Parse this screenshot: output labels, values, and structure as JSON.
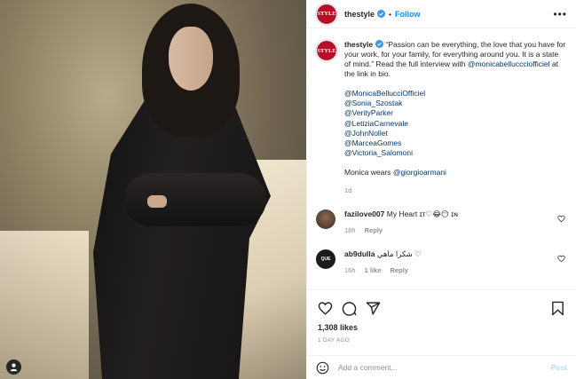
{
  "post": {
    "author": "thestyle",
    "logo_text": "STYLE",
    "follow_label": "Follow",
    "more_label": "•••",
    "caption_parts": [
      "“Passion can be everything, the love that you have for your work, for your family, for everything around you. It is a state of mind.” Read the full interview with ",
      "@monicabelluccciofficiel",
      " at the link in bio."
    ],
    "tags": [
      "@MonicaBellucciOfficiel",
      "@Sonia_Szostak",
      "@VerityParker",
      "@LetiziaCarnevale",
      "@JohnNollet",
      "@MarceaGomes",
      "@Victoria_Salomoni"
    ],
    "wears_prefix": "Monica wears ",
    "wears_tag": "@giorgioarmani",
    "caption_time": "1d"
  },
  "comments": [
    {
      "user": "fazilove007",
      "text": "My Heart ɪᴛ♡😂😶 ɪɴ",
      "time": "18h",
      "reply_label": "Reply",
      "avatar_color": "#5a4636"
    },
    {
      "user": "ab9dulla",
      "text": "شكرا ماهي ♡",
      "time": "16h",
      "likes": "1 like",
      "reply_label": "Reply",
      "avatar_color": "#1c1c1c"
    }
  ],
  "likes_count": "1,308 likes",
  "posted_ago": "1 DAY AGO",
  "add_comment": {
    "placeholder": "Add a comment...",
    "post_label": "Post"
  },
  "colors": {
    "link": "#00376b",
    "follow": "#0095f6",
    "brand": "#b50f2a"
  }
}
